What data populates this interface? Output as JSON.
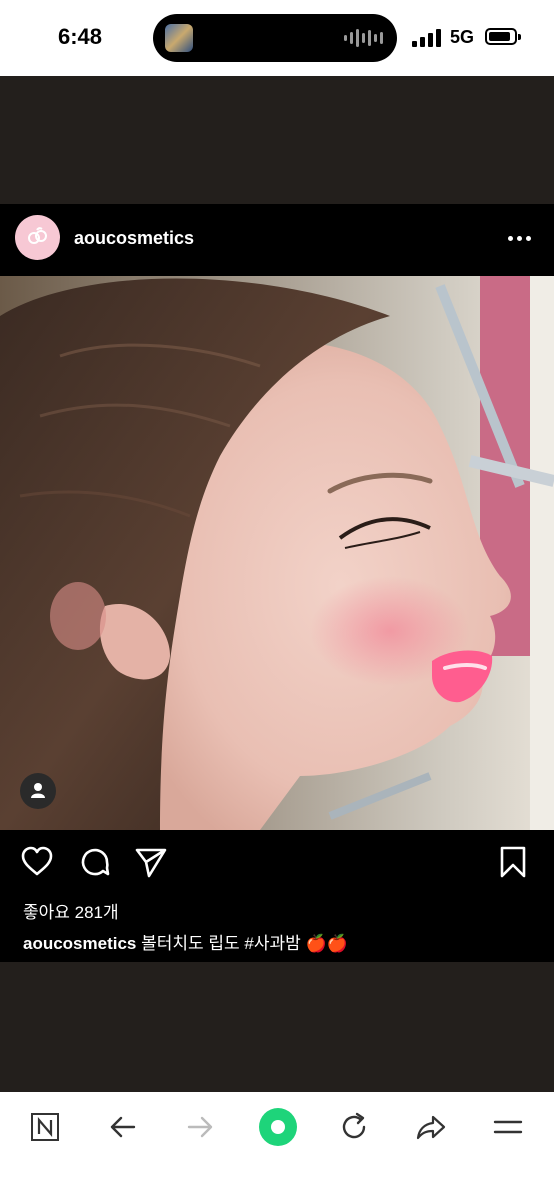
{
  "status_bar": {
    "time": "6:48",
    "network": "5G"
  },
  "post": {
    "username": "aoucosmetics",
    "likes_text": "좋아요 281개",
    "caption_user": "aoucosmetics",
    "caption_text": "볼터치도 립도 #사과밤 🍎🍎"
  },
  "icons": {
    "brand": "aou-logo",
    "more": "more-dots-icon",
    "like": "heart-icon",
    "comment": "comment-bubble-icon",
    "share": "paper-plane-icon",
    "save": "bookmark-icon",
    "tag": "person-tag-icon"
  },
  "browser_toolbar": {
    "home": "naver-n-icon",
    "back": "back-arrow-icon",
    "forward": "forward-arrow-icon",
    "green_dot": "green-dot-button",
    "reload": "reload-icon",
    "share": "share-icon",
    "menu": "menu-icon"
  },
  "colors": {
    "background": "#231f1c",
    "post_background": "#000000",
    "avatar_pink": "#f7c8d4",
    "accent_green": "#1ed47a"
  }
}
